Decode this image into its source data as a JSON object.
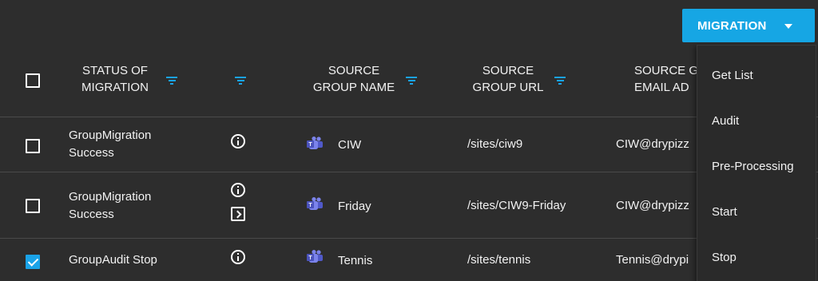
{
  "action_button": {
    "label": "MIGRATION"
  },
  "columns": {
    "status": {
      "line1": "STATUS OF",
      "line2": "MIGRATION"
    },
    "source_name": {
      "line1": "SOURCE",
      "line2": "GROUP NAME"
    },
    "source_url": {
      "line1": "SOURCE",
      "line2": "GROUP URL"
    },
    "source_email": {
      "line1": "SOURCE G",
      "line2": "EMAIL AD"
    }
  },
  "rows": [
    {
      "checked": false,
      "status_line1": "GroupMigration",
      "status_line2": "Success",
      "name": "CIW",
      "url": "/sites/ciw9",
      "email": "CIW@drypizz"
    },
    {
      "checked": false,
      "status_line1": "GroupMigration",
      "status_line2": "Success",
      "name": "Friday",
      "url": "/sites/CIW9-Friday",
      "email": "CIW@drypizz"
    },
    {
      "checked": true,
      "status_line1": "GroupAudit Stop",
      "status_line2": "",
      "name": "Tennis",
      "url": "/sites/tennis",
      "email": "Tennis@drypi"
    }
  ],
  "dropdown": {
    "items": [
      "Get List",
      "Audit",
      "Pre-Processing",
      "Start",
      "Stop"
    ]
  },
  "colors": {
    "accent": "#16a6e4",
    "background": "#2d2d2d",
    "teams": "#7b83eb"
  },
  "icons": {
    "filter": "filter-icon",
    "info": "info-icon",
    "open": "open-arrow-icon",
    "teams": "microsoft-teams-icon",
    "caret": "chevron-down-icon"
  }
}
